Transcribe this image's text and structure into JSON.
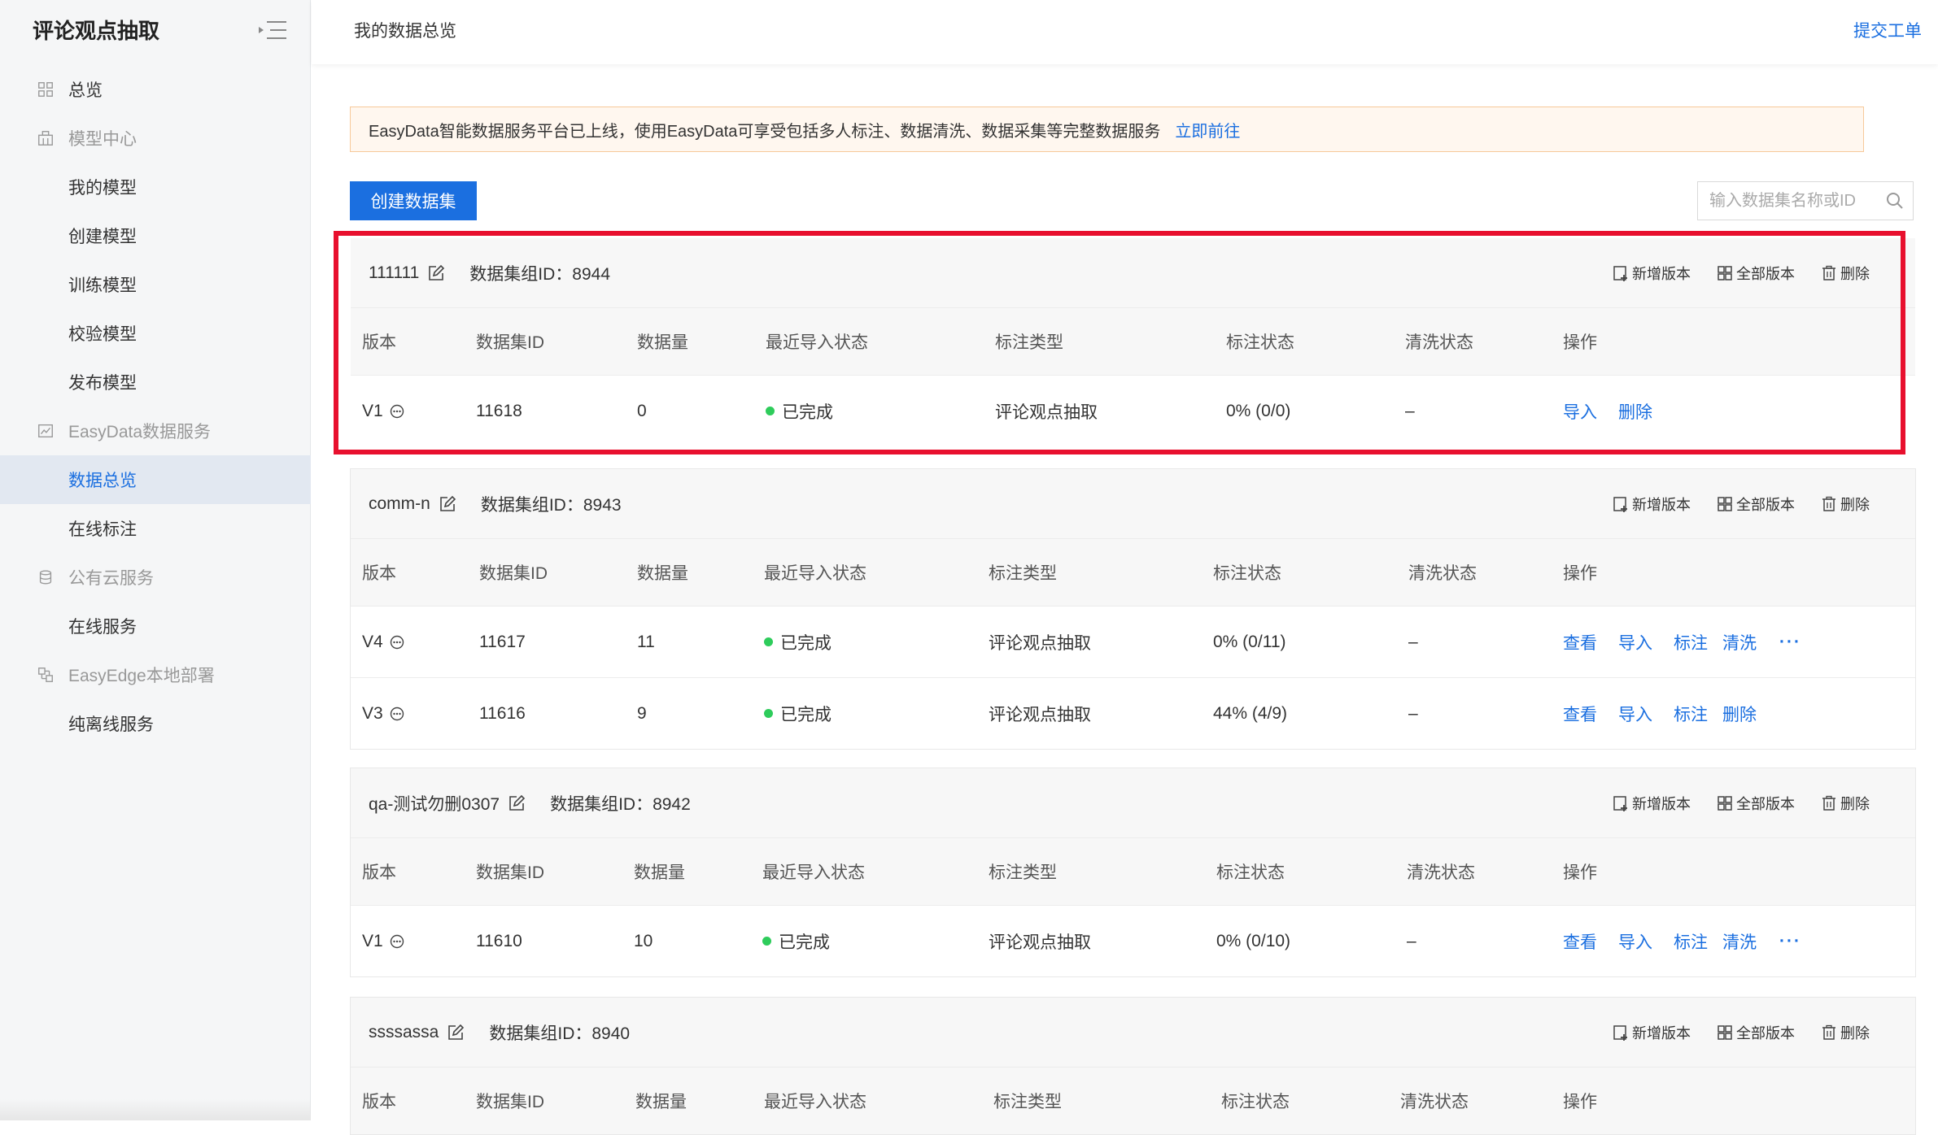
{
  "sidebar": {
    "title": "评论观点抽取",
    "items": [
      {
        "label": "总览",
        "level": "top",
        "icon": "grid-icon"
      },
      {
        "label": "模型中心",
        "level": "top",
        "muted": true,
        "icon": "model-icon"
      },
      {
        "label": "我的模型",
        "level": "sub"
      },
      {
        "label": "创建模型",
        "level": "sub"
      },
      {
        "label": "训练模型",
        "level": "sub"
      },
      {
        "label": "校验模型",
        "level": "sub"
      },
      {
        "label": "发布模型",
        "level": "sub"
      },
      {
        "label": "EasyData数据服务",
        "level": "top",
        "muted": true,
        "icon": "chart-icon"
      },
      {
        "label": "数据总览",
        "level": "sub",
        "active": true
      },
      {
        "label": "在线标注",
        "level": "sub"
      },
      {
        "label": "公有云服务",
        "level": "top",
        "muted": true,
        "icon": "cloud-icon"
      },
      {
        "label": "在线服务",
        "level": "sub"
      },
      {
        "label": "EasyEdge本地部署",
        "level": "top",
        "muted": true,
        "icon": "edge-icon"
      },
      {
        "label": "纯离线服务",
        "level": "sub"
      }
    ]
  },
  "header": {
    "title": "我的数据总览",
    "submit_ticket": "提交工单"
  },
  "notice": {
    "text": "EasyData智能数据服务平台已上线，使用EasyData可享受包括多人标注、数据清洗、数据采集等完整数据服务",
    "link": "立即前往"
  },
  "toolbar": {
    "create_button": "创建数据集",
    "search_placeholder": "输入数据集名称或ID"
  },
  "card_actions": {
    "add_version": "新增版本",
    "all_versions": "全部版本",
    "delete": "删除"
  },
  "columns": [
    "版本",
    "数据集ID",
    "数据量",
    "最近导入状态",
    "标注类型",
    "标注状态",
    "清洗状态",
    "操作"
  ],
  "datasets": [
    {
      "name": "111111",
      "group_id_label": "数据集组ID：8944",
      "rows": [
        {
          "version": "V1",
          "id": "11618",
          "count": "0",
          "import_status": "已完成",
          "type": "评论观点抽取",
          "label_status": "0% (0/0)",
          "clean_status": "–",
          "ops": [
            "导入",
            "删除"
          ],
          "more": false
        }
      ]
    },
    {
      "name": "comm-n",
      "group_id_label": "数据集组ID：8943",
      "rows": [
        {
          "version": "V4",
          "id": "11617",
          "count": "11",
          "import_status": "已完成",
          "type": "评论观点抽取",
          "label_status": "0% (0/11)",
          "clean_status": "–",
          "ops": [
            "查看",
            "导入",
            "标注",
            "清洗"
          ],
          "more": true
        },
        {
          "version": "V3",
          "id": "11616",
          "count": "9",
          "import_status": "已完成",
          "type": "评论观点抽取",
          "label_status": "44% (4/9)",
          "clean_status": "–",
          "ops": [
            "查看",
            "导入",
            "标注",
            "删除"
          ],
          "more": false
        }
      ]
    },
    {
      "name": "qa-测试勿删0307",
      "group_id_label": "数据集组ID：8942",
      "rows": [
        {
          "version": "V1",
          "id": "11610",
          "count": "10",
          "import_status": "已完成",
          "type": "评论观点抽取",
          "label_status": "0% (0/10)",
          "clean_status": "–",
          "ops": [
            "查看",
            "导入",
            "标注",
            "清洗"
          ],
          "more": true
        }
      ]
    },
    {
      "name": "ssssassa",
      "group_id_label": "数据集组ID：8940",
      "rows": []
    }
  ],
  "colors": {
    "accent": "#1b6fe0",
    "success": "#2ecc5b",
    "highlight": "#e8102e",
    "notice_bg": "#fff7ef"
  }
}
